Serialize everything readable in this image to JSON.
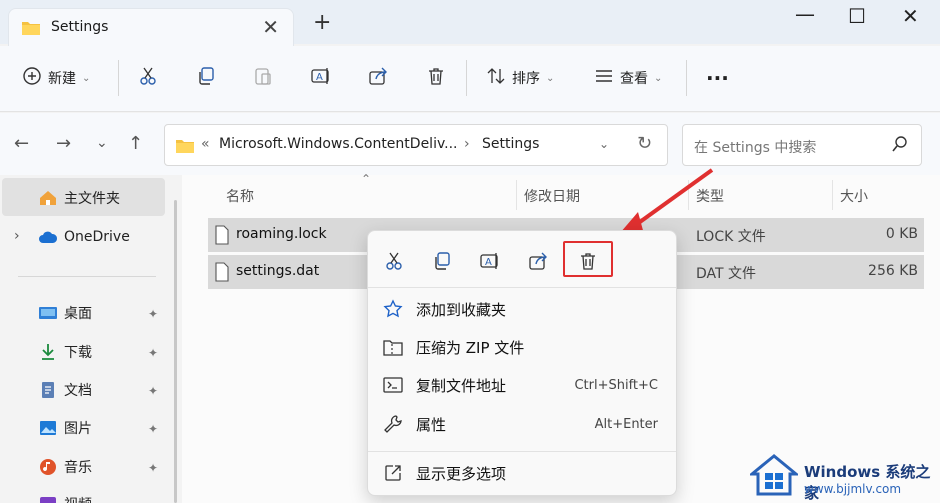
{
  "window": {
    "tab_title": "Settings",
    "tab_close": "✕",
    "new_tab": "+",
    "minimize": "—",
    "maximize": "☐",
    "close": "✕"
  },
  "toolbar": {
    "new_label": "新建",
    "sort_label": "排序",
    "view_label": "查看",
    "more": "···",
    "icons": [
      "new-icon",
      "cut-icon",
      "copy-icon",
      "paste-icon",
      "rename-icon",
      "share-icon",
      "delete-icon",
      "sort-icon",
      "view-icon",
      "more-icon"
    ]
  },
  "address": {
    "back": "←",
    "forward": "→",
    "recent": "⌄",
    "up": "↑",
    "crumb_prefix": "«",
    "crumb_parent": "Microsoft.Windows.ContentDeliv...",
    "crumb_sep": "›",
    "crumb_current": "Settings",
    "refresh": "↻"
  },
  "search": {
    "placeholder": "在 Settings 中搜索"
  },
  "sidebar": {
    "home": "主文件夹",
    "onedrive": "OneDrive",
    "expand": "›",
    "items": [
      {
        "label": "桌面",
        "icon": "desktop-icon",
        "color": "#2f7fd6"
      },
      {
        "label": "下载",
        "icon": "download-icon",
        "color": "#1a8a3c"
      },
      {
        "label": "文档",
        "icon": "document-icon",
        "color": "#4a6fa5"
      },
      {
        "label": "图片",
        "icon": "pictures-icon",
        "color": "#1e7ad6"
      },
      {
        "label": "音乐",
        "icon": "music-icon",
        "color": "#e0532a"
      },
      {
        "label": "视频",
        "icon": "video-icon",
        "color": "#7b3fc4"
      }
    ],
    "pin": "📌"
  },
  "columns": {
    "name": "名称",
    "modified": "修改日期",
    "type": "类型",
    "size": "大小"
  },
  "files": [
    {
      "name": "roaming.lock",
      "type": "LOCK 文件",
      "size": "0 KB"
    },
    {
      "name": "settings.dat",
      "type": "DAT 文件",
      "size": "256 KB"
    }
  ],
  "context_menu": {
    "icons": [
      "cut-icon",
      "copy-icon",
      "rename-icon",
      "share-icon",
      "delete-icon"
    ],
    "items": [
      {
        "label": "添加到收藏夹",
        "shortcut": ""
      },
      {
        "label": "压缩为 ZIP 文件",
        "shortcut": ""
      },
      {
        "label": "复制文件地址",
        "shortcut": "Ctrl+Shift+C"
      },
      {
        "label": "属性",
        "shortcut": "Alt+Enter"
      },
      {
        "label": "显示更多选项",
        "shortcut": ""
      }
    ]
  },
  "watermark": {
    "title": "Windows 系统之家",
    "url": "www.bjjmlv.com"
  },
  "colors": {
    "highlight_red": "#e03030",
    "selection_gray": "#d9d9d9"
  }
}
